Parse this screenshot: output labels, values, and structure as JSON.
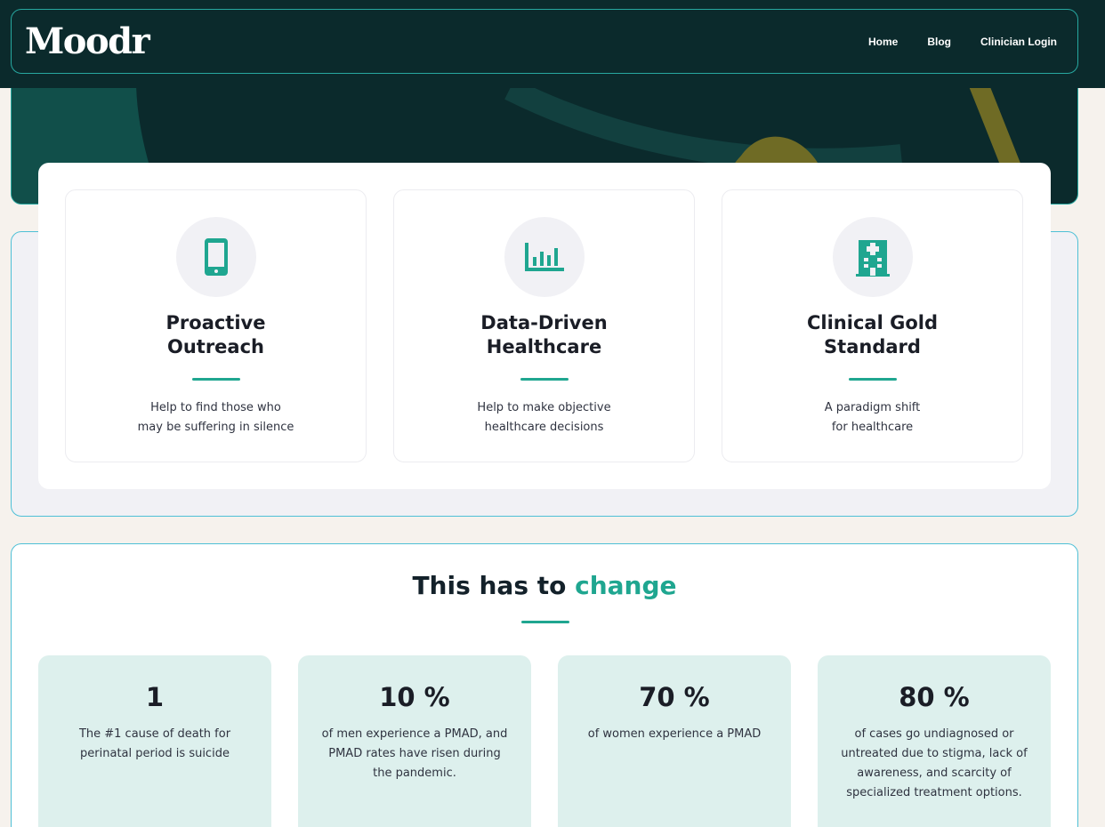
{
  "header": {
    "logo": "Moodr",
    "nav": [
      {
        "label": "Home"
      },
      {
        "label": "Blog"
      },
      {
        "label": "Clinician Login"
      }
    ]
  },
  "features": [
    {
      "icon": "smartphone-icon",
      "title": "Proactive\nOutreach",
      "description": "Help to find those who\nmay be suffering in silence"
    },
    {
      "icon": "bar-chart-icon",
      "title": "Data-Driven\nHealthcare",
      "description": "Help to make objective\nhealthcare decisions"
    },
    {
      "icon": "hospital-icon",
      "title": "Clinical Gold\nStandard",
      "description": "A paradigm shift\nfor healthcare"
    }
  ],
  "stats_section": {
    "heading_prefix": "This has to",
    "heading_accent": "change",
    "stats": [
      {
        "value": "1",
        "description": "The #1 cause of death for perinatal period is suicide"
      },
      {
        "value": "10 %",
        "description": "of men experience a PMAD, and PMAD rates have risen during the pandemic."
      },
      {
        "value": "70 %",
        "description": "of women experience a PMAD"
      },
      {
        "value": "80 %",
        "description": "of cases go undiagnosed or untreated due to stigma, lack of awareness, and scarcity of specialized treatment options."
      }
    ]
  },
  "colors": {
    "dark_teal": "#0b2a2c",
    "accent": "#1fa690",
    "page_background": "#f6f2ed",
    "stat_card_background": "#ddf0ed",
    "border": "#4ec0d6"
  }
}
